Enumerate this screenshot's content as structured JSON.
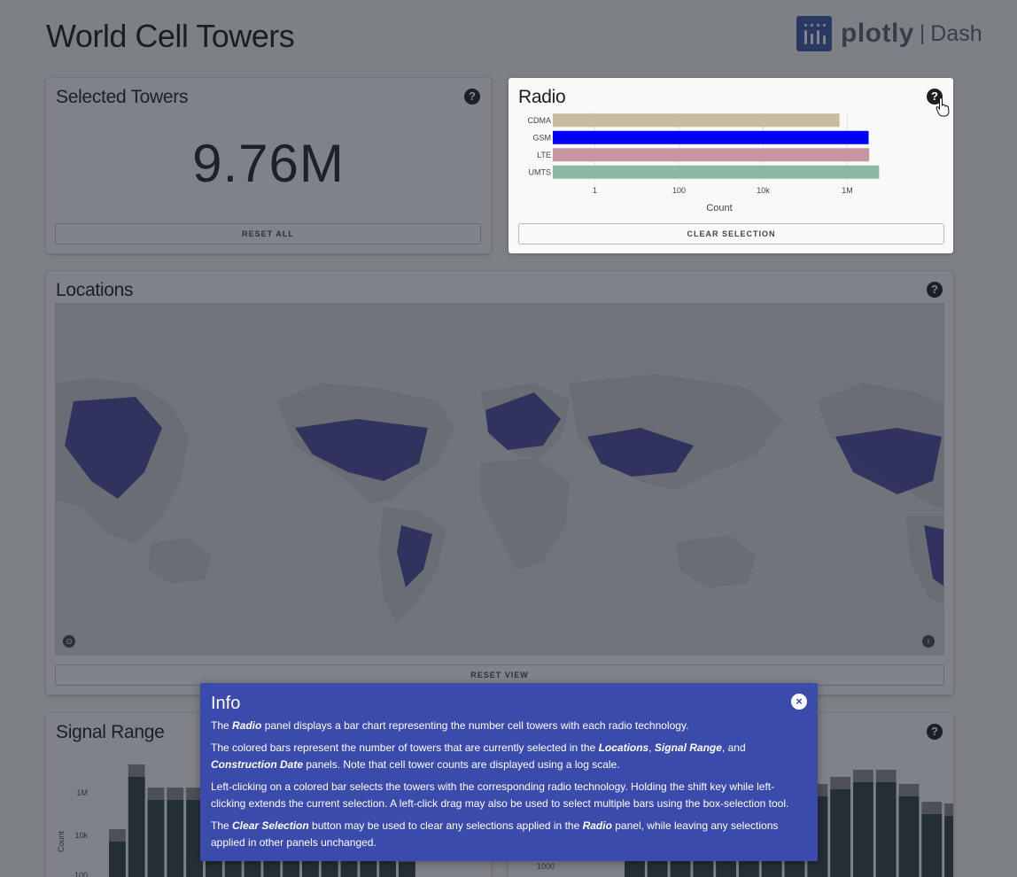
{
  "header": {
    "title": "World Cell Towers",
    "logo_word": "plotly",
    "logo_sep": "|",
    "logo_dash": "Dash"
  },
  "selected": {
    "title": "Selected Towers",
    "value": "9.76M",
    "reset_label": "RESET ALL"
  },
  "radio": {
    "title": "Radio",
    "clear_label": "CLEAR SELECTION",
    "chart_data": {
      "type": "bar",
      "orientation": "horizontal",
      "categories": [
        "CDMA",
        "GSM",
        "LTE",
        "UMTS"
      ],
      "values": [
        650000,
        3200000,
        3300000,
        5700000
      ],
      "colors": [
        "#c7bc9d",
        "#0000ff",
        "#c595a2",
        "#8db9a4"
      ],
      "xlabel": "Count",
      "xscale": "log",
      "xticks": [
        "1",
        "100",
        "10k",
        "1M"
      ],
      "xlim": [
        0.1,
        10000000
      ]
    }
  },
  "locations": {
    "title": "Locations",
    "reset_label": "RESET VIEW"
  },
  "signal": {
    "title": "Signal Range",
    "ylabel": "Count",
    "yticks": [
      "1M",
      "10k",
      "100"
    ]
  },
  "construction": {
    "ytick_visible": "1000"
  },
  "info": {
    "title": "Info",
    "p1_a": "The ",
    "p1_b": "Radio",
    "p1_c": " panel displays a bar chart representing the number cell towers with each radio technology.",
    "p2_a": "The colored bars represent the number of towers that are currently selected in the ",
    "p2_b": "Locations",
    "p2_c": ", ",
    "p2_d": "Signal Range",
    "p2_e": ", and ",
    "p2_f": "Construction Date",
    "p2_g": " panels. Note that cell tower counts are displayed using a log scale.",
    "p3": "Left-clicking on a colored bar selects the towers with the corresponding radio technology. Holding the shift key while left-clicking extends the current selection. A left-click drag may also be used to select multiple bars using the box-selection tool.",
    "p4_a": "The ",
    "p4_b": "Clear Selection",
    "p4_c": " button may be used to clear any selections applied in the ",
    "p4_d": "Radio",
    "p4_e": " panel, while leaving any selections applied in other panels unchanged."
  },
  "icons": {
    "help": "question-circle-icon",
    "close": "close-circle-icon",
    "info": "info-icon",
    "mapbox": "mapbox-logo-icon"
  }
}
